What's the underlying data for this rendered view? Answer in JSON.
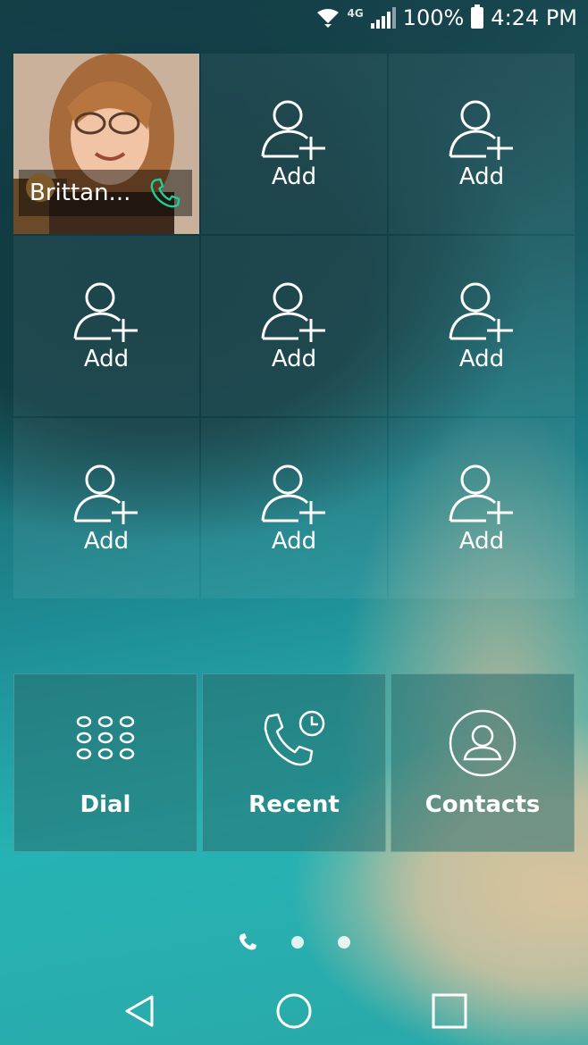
{
  "status_bar": {
    "network": "4G",
    "battery_text": "100%",
    "time": "4:24 PM"
  },
  "speed_dial": {
    "contact": {
      "name": "Brittan..."
    },
    "add_label": "Add",
    "add_slots": 8
  },
  "actions": [
    {
      "label": "Dial",
      "icon": "dialpad-icon"
    },
    {
      "label": "Recent",
      "icon": "recent-calls-icon"
    },
    {
      "label": "Contacts",
      "icon": "contacts-icon"
    }
  ],
  "pager": {
    "pages": 3,
    "current": 0
  },
  "navbar": {
    "buttons": [
      "back-icon",
      "home-icon",
      "recents-icon"
    ]
  },
  "colors": {
    "call_accent": "#1ecf9a"
  }
}
